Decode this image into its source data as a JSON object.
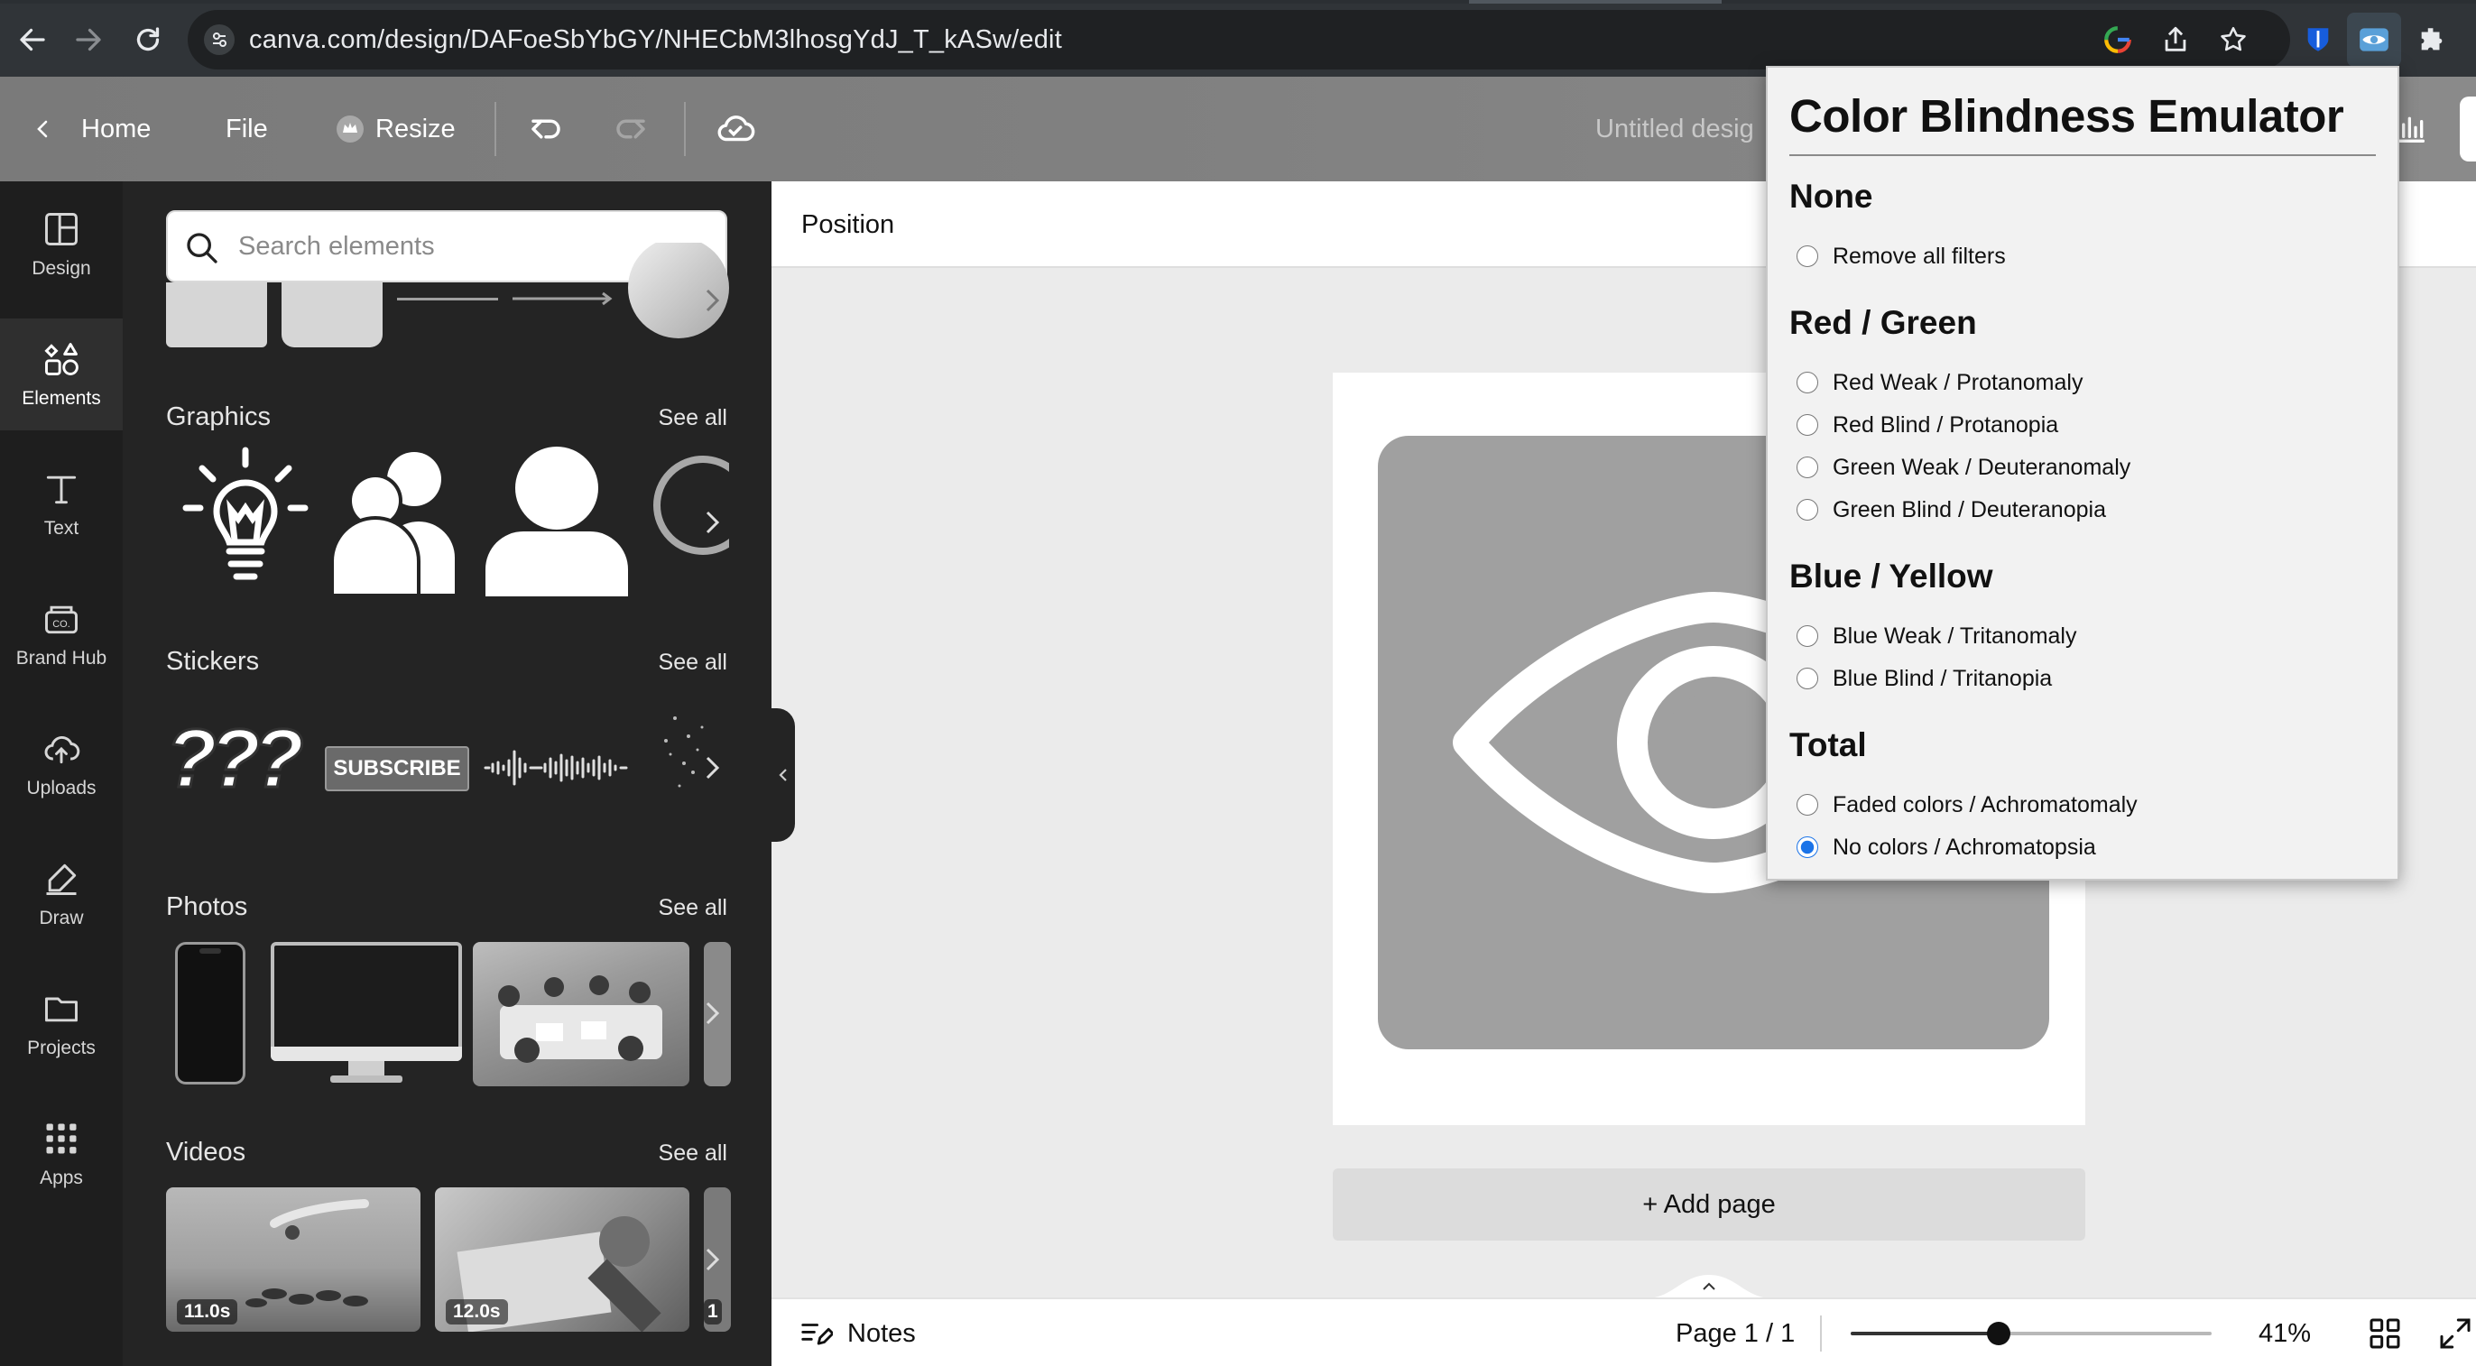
{
  "browser": {
    "url": "canva.com/design/DAFoeSbYbGY/NHECbM3lhosgYdJ_T_kASw/edit"
  },
  "header": {
    "home_label": "Home",
    "file_label": "File",
    "resize_label": "Resize",
    "design_title": "Untitled desig"
  },
  "rail": {
    "items": [
      {
        "label": "Design"
      },
      {
        "label": "Elements"
      },
      {
        "label": "Text"
      },
      {
        "label": "Brand Hub"
      },
      {
        "label": "Uploads"
      },
      {
        "label": "Draw"
      },
      {
        "label": "Projects"
      },
      {
        "label": "Apps"
      }
    ]
  },
  "panel": {
    "search_placeholder": "Search elements",
    "sections": [
      {
        "title": "Graphics",
        "see_all": "See all"
      },
      {
        "title": "Stickers",
        "see_all": "See all"
      },
      {
        "title": "Photos",
        "see_all": "See all"
      },
      {
        "title": "Videos",
        "see_all": "See all"
      }
    ],
    "sticker_subscribe": "SUBSCRIBE",
    "sticker_question": "???",
    "videos": [
      {
        "duration": "11.0s"
      },
      {
        "duration": "12.0s"
      },
      {
        "duration": "1"
      }
    ]
  },
  "canvas": {
    "context_label": "Position",
    "add_page_label": "+ Add page"
  },
  "bottom": {
    "notes_label": "Notes",
    "page_count": "Page 1 / 1",
    "zoom": "41%",
    "zoom_fraction": 0.41
  },
  "extension": {
    "title": "Color Blindness Emulator",
    "groups": [
      {
        "title": "None",
        "options": [
          {
            "label": "Remove all filters",
            "checked": false
          }
        ]
      },
      {
        "title": "Red / Green",
        "options": [
          {
            "label": "Red Weak / Protanomaly",
            "checked": false
          },
          {
            "label": "Red Blind / Protanopia",
            "checked": false
          },
          {
            "label": "Green Weak / Deuteranomaly",
            "checked": false
          },
          {
            "label": "Green Blind / Deuteranopia",
            "checked": false
          }
        ]
      },
      {
        "title": "Blue / Yellow",
        "options": [
          {
            "label": "Blue Weak / Tritanomaly",
            "checked": false
          },
          {
            "label": "Blue Blind / Tritanopia",
            "checked": false
          }
        ]
      },
      {
        "title": "Total",
        "options": [
          {
            "label": "Faded colors / Achromatomaly",
            "checked": false
          },
          {
            "label": "No colors / Achromatopsia",
            "checked": true
          }
        ]
      }
    ]
  },
  "colors": {
    "accent": "#1a73e8",
    "panel_bg": "#242424",
    "rail_bg": "#1e1e1e",
    "header_gray": "#808080",
    "artwork_gray": "#a0a0a0"
  }
}
